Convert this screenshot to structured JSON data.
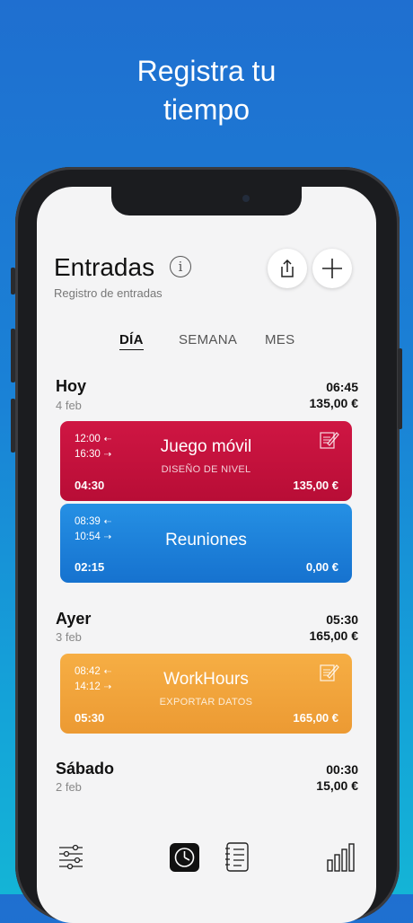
{
  "headline": [
    "Registra tu",
    "tiempo"
  ],
  "header": {
    "title": "Entradas",
    "info_glyph": "i",
    "subtitle": "Registro de entradas",
    "share_icon": "share-icon",
    "add_icon": "plus-icon"
  },
  "tabs": [
    "DÍA",
    "SEMANA",
    "MES"
  ],
  "days": [
    {
      "title": "Hoy",
      "date": "4 feb",
      "total_time": "06:45",
      "total_amount": "135,00 €"
    },
    {
      "title": "Ayer",
      "date": "3 feb",
      "total_time": "05:30",
      "total_amount": "165,00 €"
    },
    {
      "title": "Sábado",
      "date": "2 feb",
      "total_time": "00:30",
      "total_amount": "15,00 €"
    }
  ],
  "entries": [
    {
      "start": "12:00",
      "end": "16:30",
      "name": "Juego móvil",
      "task": "DISEÑO DE NIVEL",
      "duration": "04:30",
      "amount": "135,00 €",
      "color": "#c8103a"
    },
    {
      "start": "08:39",
      "end": "10:54",
      "name": "Reuniones",
      "task": "",
      "duration": "02:15",
      "amount": "0,00 €",
      "color": "#1c7fd8"
    },
    {
      "start": "08:42",
      "end": "14:12",
      "name": "WorkHours",
      "task": "EXPORTAR DATOS",
      "duration": "05:30",
      "amount": "165,00 €",
      "color": "#f0a23a"
    }
  ],
  "tabbar": [
    "filters-icon",
    "clock-icon",
    "notebook-icon",
    "bar-chart-icon"
  ]
}
